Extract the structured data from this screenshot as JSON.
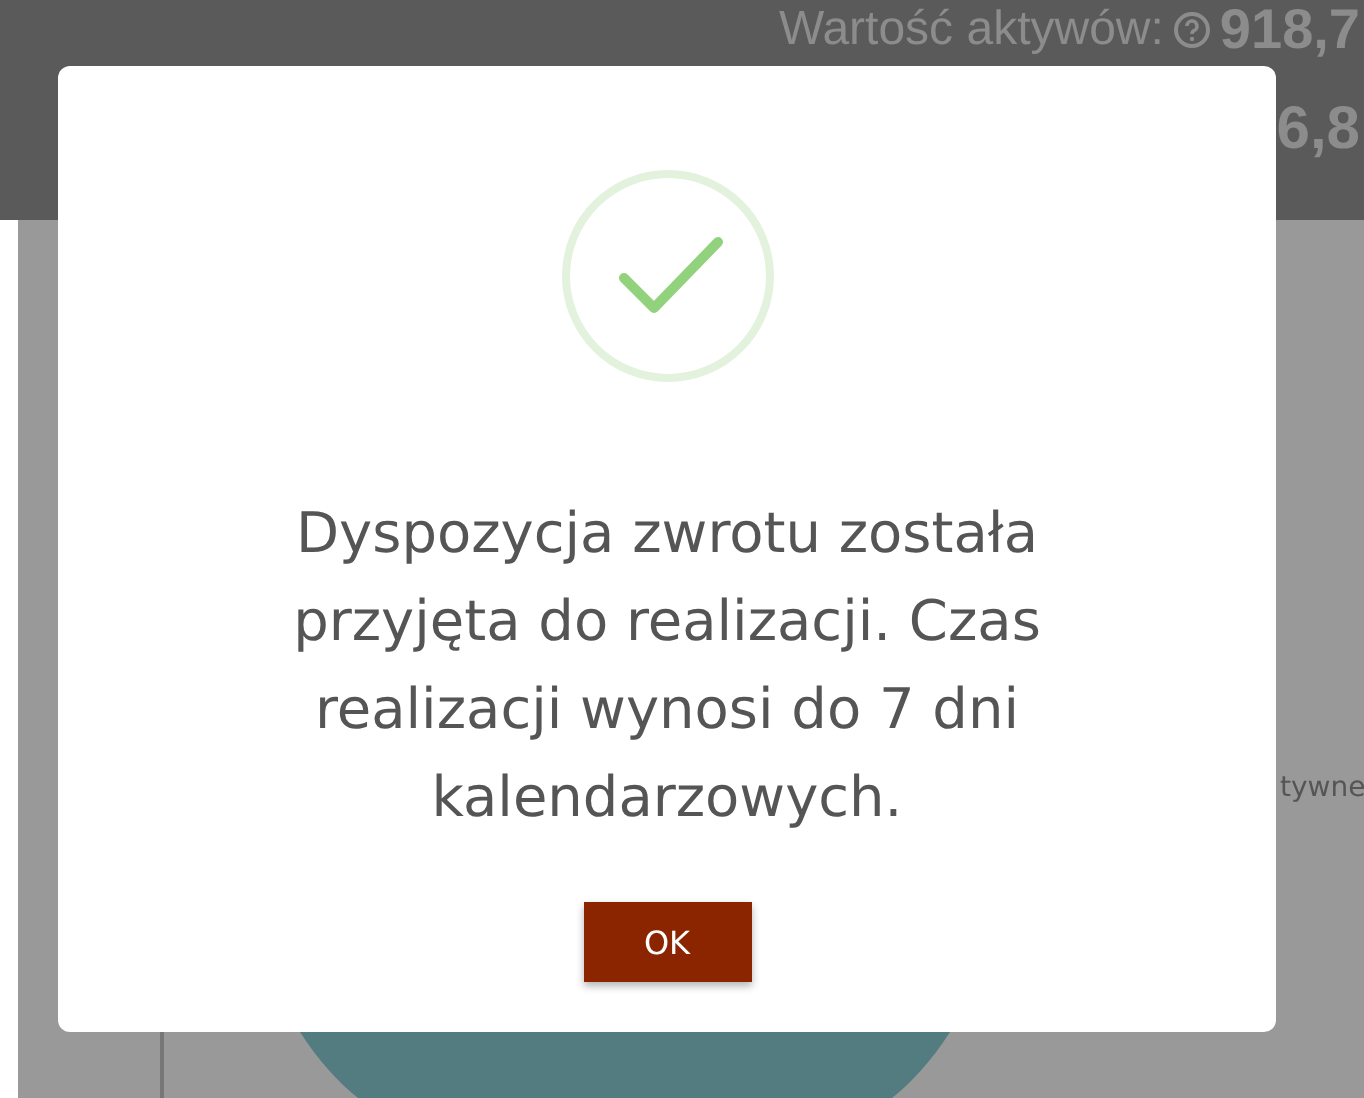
{
  "header": {
    "assets_label": "Wartość aktywów:",
    "assets_value": "918,7",
    "second_value": "6,8"
  },
  "content": {
    "side_text": "tywne"
  },
  "dialog": {
    "message": "Dyspozycja zwrotu została przyjęta do realizacji. Czas realizacji wynosi do 7 dni kalendarzowych.",
    "button": "OK"
  }
}
